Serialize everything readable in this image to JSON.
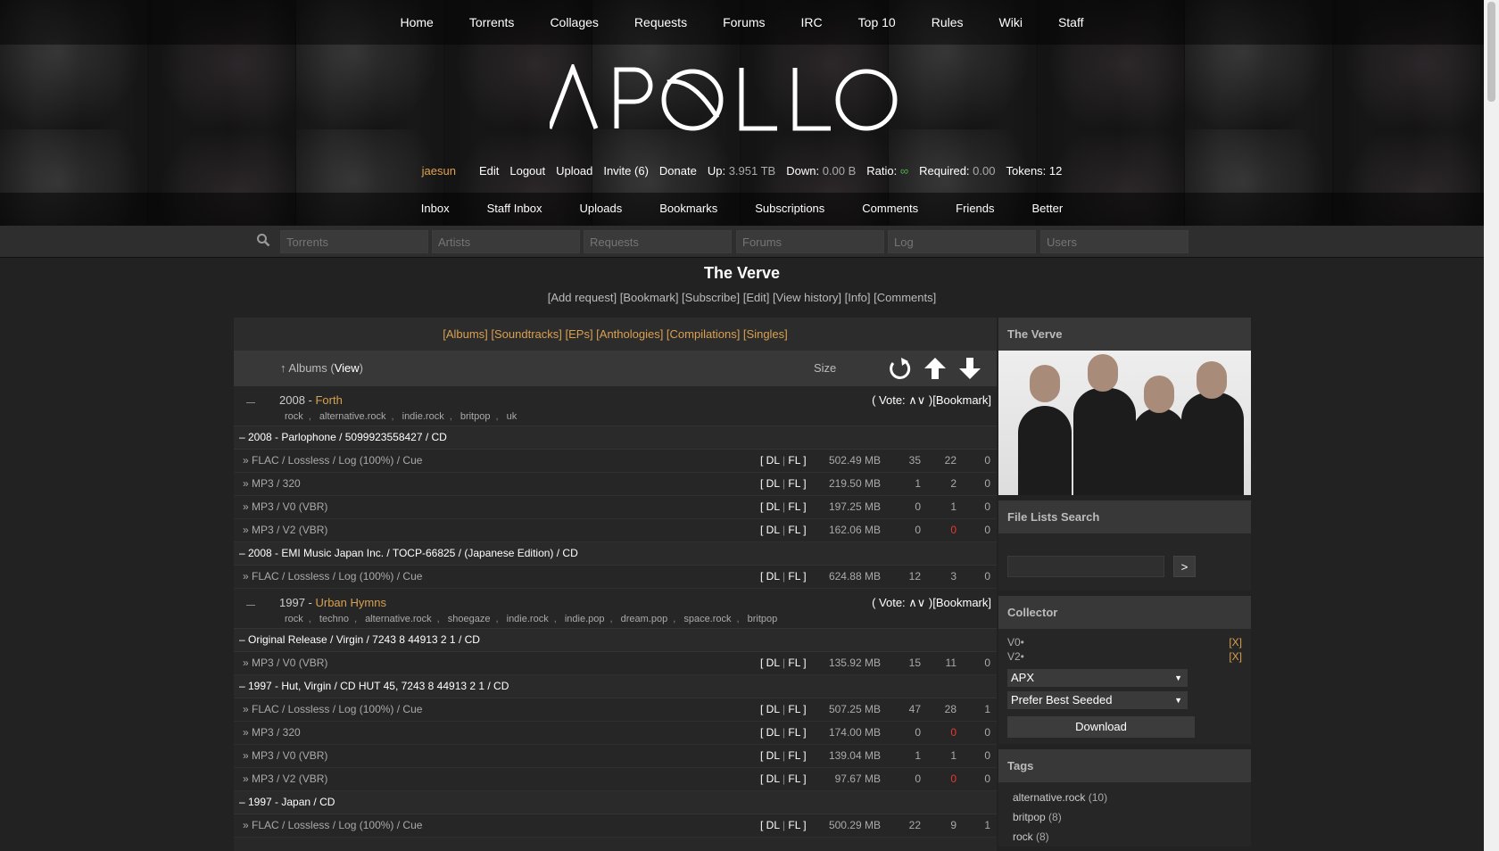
{
  "topnav": [
    "Home",
    "Torrents",
    "Collages",
    "Requests",
    "Forums",
    "IRC",
    "Top 10",
    "Rules",
    "Wiki",
    "Staff"
  ],
  "logo_text": "APOLLO",
  "userbar": {
    "username": "jaesun",
    "links": [
      "Edit",
      "Logout",
      "Upload",
      "Invite (6)",
      "Donate"
    ],
    "up_label": "Up:",
    "up_value": "3.951 TB",
    "down_label": "Down:",
    "down_value": "0.00 B",
    "ratio_label": "Ratio:",
    "ratio_value": "∞",
    "required_label": "Required:",
    "required_value": "0.00",
    "tokens": "Tokens: 12"
  },
  "subnav": [
    "Inbox",
    "Staff Inbox",
    "Uploads",
    "Bookmarks",
    "Subscriptions",
    "Comments",
    "Friends",
    "Better"
  ],
  "search": {
    "placeholders": [
      "Torrents",
      "Artists",
      "Requests",
      "Forums",
      "Log",
      "Users"
    ]
  },
  "artist_title": "The Verve",
  "artist_links": "[Add request] [Bookmark] [Subscribe] [Edit] [View history] [Info] [Comments]",
  "filter_links": "[Albums] [Soundtracks] [EPs] [Anthologies] [Compilations] [Singles]",
  "albums_header": {
    "arrow": "↑",
    "label": "Albums",
    "view": "View",
    "size": "Size"
  },
  "groups": [
    {
      "year": "2008",
      "title": "Forth",
      "tags": [
        "rock",
        "alternative.rock",
        "indie.rock",
        "britpop",
        "uk"
      ],
      "vote": "( Vote: ∧∨ )[Bookmark]",
      "editions": [
        {
          "label": "– 2008 - Parlophone / 5099923558427 / CD",
          "rows": [
            {
              "fmt": "» FLAC / Lossless / Log (100%) / Cue",
              "size": "502.49 MB",
              "s": "35",
              "l": "22",
              "c": "0"
            },
            {
              "fmt": "» MP3 / 320",
              "size": "219.50 MB",
              "s": "1",
              "l": "2",
              "c": "0"
            },
            {
              "fmt": "» MP3 / V0 (VBR)",
              "size": "197.25 MB",
              "s": "0",
              "l": "1",
              "c": "0"
            },
            {
              "fmt": "» MP3 / V2 (VBR)",
              "size": "162.06 MB",
              "s": "0",
              "l": "0",
              "c": "0",
              "lred": true
            }
          ]
        },
        {
          "label": "– 2008 - EMI Music Japan Inc. / TOCP-66825 / (Japanese Edition) / CD",
          "rows": [
            {
              "fmt": "» FLAC / Lossless / Log (100%) / Cue",
              "size": "624.88 MB",
              "s": "12",
              "l": "3",
              "c": "0"
            }
          ]
        }
      ]
    },
    {
      "year": "1997",
      "title": "Urban Hymns",
      "tags": [
        "rock",
        "techno",
        "alternative.rock",
        "shoegaze",
        "indie.rock",
        "indie.pop",
        "dream.pop",
        "space.rock",
        "britpop"
      ],
      "vote": "( Vote: ∧∨ )[Bookmark]",
      "editions": [
        {
          "label": "– Original Release / Virgin / 7243 8 44913 2 1 / CD",
          "rows": [
            {
              "fmt": "» MP3 / V0 (VBR)",
              "size": "135.92 MB",
              "s": "15",
              "l": "11",
              "c": "0"
            }
          ]
        },
        {
          "label": "– 1997 - Hut, Virgin / CD HUT 45, 7243 8 44913 2 1 / CD",
          "rows": [
            {
              "fmt": "» FLAC / Lossless / Log (100%) / Cue",
              "size": "507.25 MB",
              "s": "47",
              "l": "28",
              "c": "1"
            },
            {
              "fmt": "» MP3 / 320",
              "size": "174.00 MB",
              "s": "0",
              "l": "0",
              "c": "0",
              "lred": true
            },
            {
              "fmt": "» MP3 / V0 (VBR)",
              "size": "139.04 MB",
              "s": "1",
              "l": "1",
              "c": "0"
            },
            {
              "fmt": "» MP3 / V2 (VBR)",
              "size": "97.67 MB",
              "s": "0",
              "l": "0",
              "c": "0",
              "lred": true
            }
          ]
        },
        {
          "label": "– 1997 - Japan / CD",
          "rows": [
            {
              "fmt": "» FLAC / Lossless / Log (100%) / Cue",
              "size": "500.29 MB",
              "s": "22",
              "l": "9",
              "c": "1"
            }
          ]
        }
      ]
    }
  ],
  "dl_fl": {
    "open": "[ ",
    "dl": "DL",
    "sep": " | ",
    "fl": "FL",
    "close": " ]"
  },
  "sidebar": {
    "artist_box": "The Verve",
    "file_search": {
      "title": "File Lists Search",
      "button": ">"
    },
    "collector": {
      "title": "Collector",
      "items": [
        "V0•",
        "V2•"
      ],
      "remove": "[X]",
      "select1": "APX",
      "select2": "Prefer Best Seeded",
      "download": "Download"
    },
    "tags": {
      "title": "Tags",
      "items": [
        {
          "name": "alternative.rock",
          "count": "(10)"
        },
        {
          "name": "britpop",
          "count": "(8)"
        },
        {
          "name": "rock",
          "count": "(8)"
        }
      ]
    }
  },
  "colors": {
    "accent": "#d9a050",
    "ratio": "#4caf50",
    "alert": "#e53935"
  }
}
